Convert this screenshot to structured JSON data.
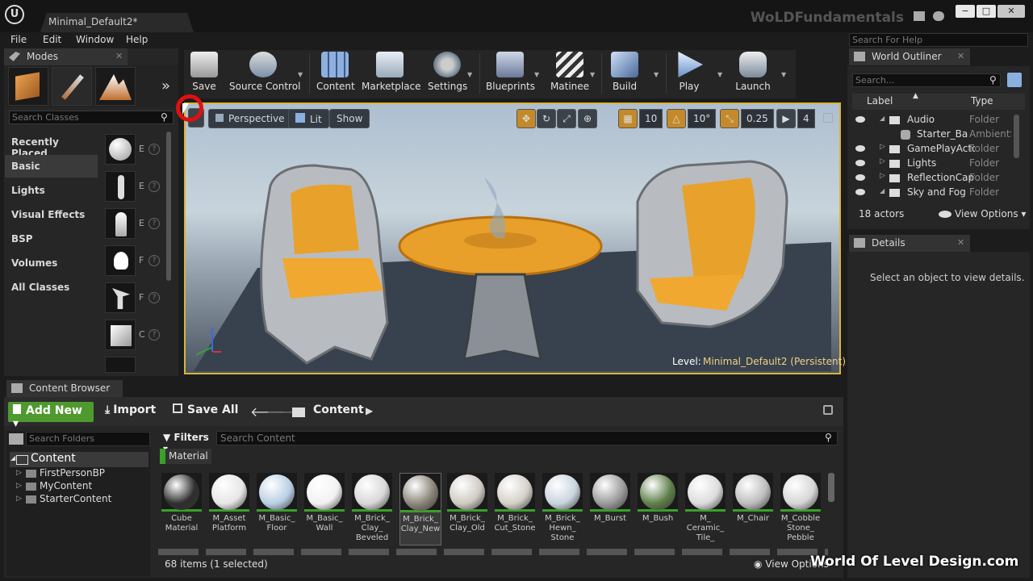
{
  "window": {
    "app_logo": "U",
    "document_tab": "Minimal_Default2*",
    "project_name": "WoLDFundamentals"
  },
  "menu": [
    "File",
    "Edit",
    "Window",
    "Help"
  ],
  "help_search": {
    "placeholder": "Search For Help"
  },
  "modes": {
    "tab_label": "Modes",
    "search_placeholder": "Search Classes",
    "categories": [
      "Recently Placed",
      "Basic",
      "Lights",
      "Visual Effects",
      "BSP",
      "Volumes",
      "All Classes"
    ],
    "selected_category": "Basic",
    "item_letters": [
      "E",
      "E",
      "E",
      "F",
      "F",
      "C"
    ]
  },
  "toolbar": {
    "items": [
      "Save",
      "Source Control",
      "Content",
      "Marketplace",
      "Settings",
      "Blueprints",
      "Matinee",
      "Build",
      "Play",
      "Launch"
    ]
  },
  "viewport": {
    "perspective": "Perspective",
    "lit": "Lit",
    "show": "Show",
    "grid_snap": "10",
    "rotation_snap": "10°",
    "scale_snap": "0.25",
    "camera_speed": "4",
    "level_label": "Level:",
    "level_name": "Minimal_Default2 (Persistent)"
  },
  "outliner": {
    "tab_label": "World Outliner",
    "search_placeholder": "Search...",
    "col_label": "Label",
    "col_type": "Type",
    "rows": [
      {
        "label": "Audio",
        "type": "Folder"
      },
      {
        "label": "Starter_Background_Cue",
        "type": "AmbientSound"
      },
      {
        "label": "GamePlayActors",
        "type": "Folder"
      },
      {
        "label": "Lights",
        "type": "Folder"
      },
      {
        "label": "ReflectionCaptures",
        "type": "Folder"
      },
      {
        "label": "Sky and Fog",
        "type": "Folder"
      }
    ],
    "actor_count": "18 actors",
    "view_options": "View Options"
  },
  "details": {
    "tab_label": "Details",
    "empty_message": "Select an object to view details."
  },
  "content_browser": {
    "tab_label": "Content Browser",
    "add_new": "Add New",
    "import": "Import",
    "save_all": "Save All",
    "path": "Content",
    "folder_search_placeholder": "Search Folders",
    "folders": {
      "root": "Content",
      "children": [
        "FirstPersonBP",
        "MyContent",
        "StarterContent"
      ]
    },
    "filters": "Filters",
    "search_placeholder": "Search Content",
    "active_filter": "Material",
    "assets": [
      {
        "name": "Cube Material",
        "color": "#2e2e2e"
      },
      {
        "name": "M_Asset Platform",
        "color": "#e6e6e6"
      },
      {
        "name": "M_Basic_ Floor",
        "color": "#b9cfe4"
      },
      {
        "name": "M_Basic_ Wall",
        "color": "#f2f2f2"
      },
      {
        "name": "M_Brick_ Clay_ Beveled",
        "color": "#d8d8d8"
      },
      {
        "name": "M_Brick_ Clay_New",
        "color": "#8a8378"
      },
      {
        "name": "M_Brick_ Clay_Old",
        "color": "#cfcac2"
      },
      {
        "name": "M_Brick_ Cut_Stone",
        "color": "#d4d0c8"
      },
      {
        "name": "M_Brick_ Hewn_ Stone",
        "color": "#c9d4de"
      },
      {
        "name": "M_Burst",
        "color": "#9a9a9a"
      },
      {
        "name": "M_Bush",
        "color": "#5f7f4a"
      },
      {
        "name": "M_ Ceramic_ Tile_",
        "color": "#dcdcdc"
      },
      {
        "name": "M_Chair",
        "color": "#bdbdbd"
      },
      {
        "name": "M_Cobble Stone_ Pebble",
        "color": "#d6d6d6"
      }
    ],
    "selected_asset": "M_Brick_ Clay_New",
    "item_count": "68 items (1 selected)",
    "view_options": "View Options"
  },
  "watermark": "World Of Level Design.com"
}
